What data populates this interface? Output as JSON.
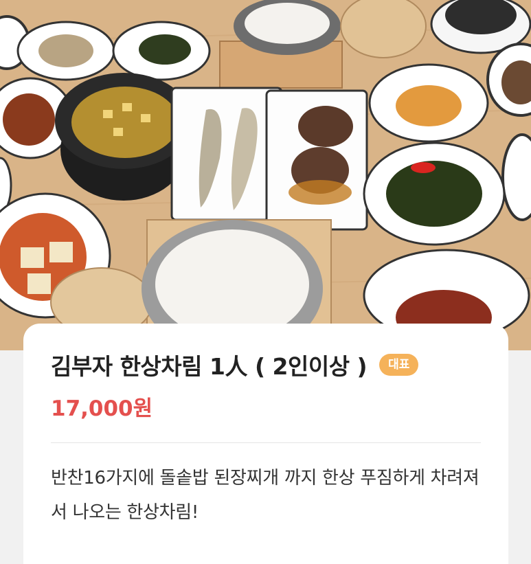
{
  "menu_item": {
    "image_alt_icon": "korean-table-setting-photo",
    "name": "김부자 한상차림 1人 ( 2인이상 )",
    "badge": "대표",
    "price": "17,000원",
    "description": "반찬16가지에 돌솥밥 된장찌개 까지 한상 푸짐하게 차려져서 나오는 한상차림!"
  },
  "colors": {
    "price": "#e4504e",
    "badge_bg": "#f5b25a",
    "table_wood": "#d9b489"
  }
}
